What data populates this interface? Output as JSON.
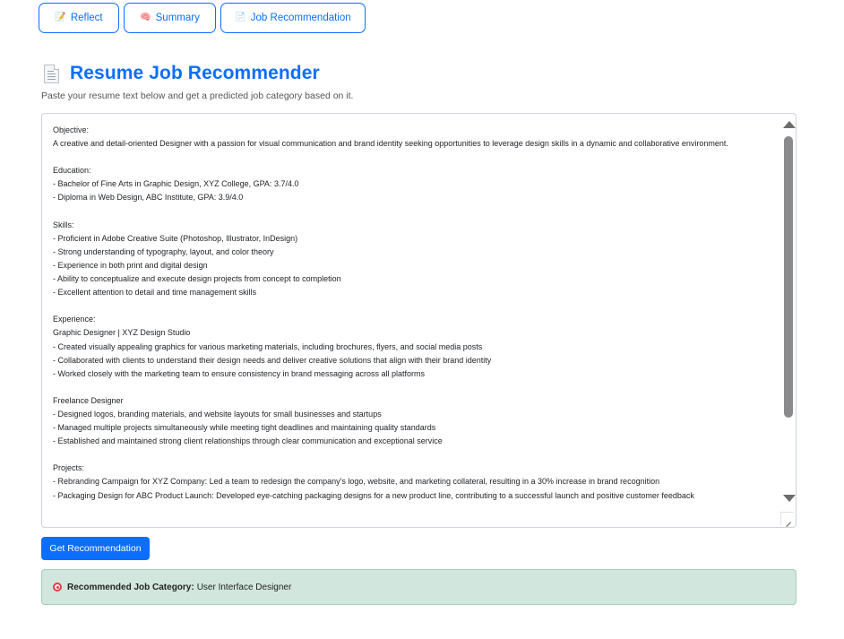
{
  "nav": {
    "items": [
      {
        "label": "Reflect",
        "icon": "memo-icon"
      },
      {
        "label": "Summary",
        "icon": "brain-icon"
      },
      {
        "label": "Job Recommendation",
        "icon": "page-icon"
      }
    ]
  },
  "header": {
    "title": "Resume Job Recommender",
    "subtitle": "Paste your resume text below and get a predicted job category based on it."
  },
  "resume": {
    "value": "Objective:\nA creative and detail-oriented Designer with a passion for visual communication and brand identity seeking opportunities to leverage design skills in a dynamic and collaborative environment.\n\nEducation:\n- Bachelor of Fine Arts in Graphic Design, XYZ College, GPA: 3.7/4.0\n- Diploma in Web Design, ABC Institute, GPA: 3.9/4.0\n\nSkills:\n- Proficient in Adobe Creative Suite (Photoshop, Illustrator, InDesign)\n- Strong understanding of typography, layout, and color theory\n- Experience in both print and digital design\n- Ability to conceptualize and execute design projects from concept to completion\n- Excellent attention to detail and time management skills\n\nExperience:\nGraphic Designer | XYZ Design Studio\n- Created visually appealing graphics for various marketing materials, including brochures, flyers, and social media posts\n- Collaborated with clients to understand their design needs and deliver creative solutions that align with their brand identity\n- Worked closely with the marketing team to ensure consistency in brand messaging across all platforms\n\nFreelance Designer\n- Designed logos, branding materials, and website layouts for small businesses and startups\n- Managed multiple projects simultaneously while meeting tight deadlines and maintaining quality standards\n- Established and maintained strong client relationships through clear communication and exceptional service\n\nProjects:\n- Rebranding Campaign for XYZ Company: Led a team to redesign the company's logo, website, and marketing collateral, resulting in a 30% increase in brand recognition\n- Packaging Design for ABC Product Launch: Developed eye-catching packaging designs for a new product line, contributing to a successful launch and positive customer feedback"
  },
  "actions": {
    "submit_label": "Get Recommendation"
  },
  "result": {
    "label": "Recommended Job Category:",
    "value": "User Interface Designer",
    "icon": "target-icon"
  },
  "colors": {
    "accent": "#0d6efd",
    "success_bg": "#d1e7dd",
    "success_border": "#a3cfbb"
  }
}
